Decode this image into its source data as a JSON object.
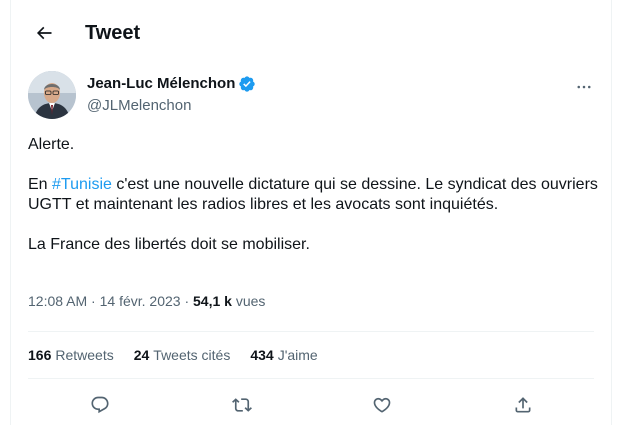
{
  "header": {
    "title": "Tweet",
    "back_icon": "arrow-left-icon"
  },
  "author": {
    "name": "Jean-Luc Mélenchon",
    "handle": "@JLMelenchon",
    "verified_color": "#1d9bf0"
  },
  "tweet": {
    "line1": "Alerte.",
    "p2_prefix": "En ",
    "p2_hashtag": "#Tunisie",
    "p2_rest": " c'est une nouvelle dictature qui se dessine. Le syndicat des ouvriers UGTT et maintenant les radios libres et les avocats sont inquiétés.",
    "line3": "La France des libertés doit se mobiliser."
  },
  "meta": {
    "time": "12:08 AM",
    "sep1": " · ",
    "date": "14 févr. 2023",
    "sep2": " · ",
    "views_count": "54,1 k",
    "views_label": " vues"
  },
  "stats": {
    "retweets_count": "166",
    "retweets_label": "Retweets",
    "quotes_count": "24",
    "quotes_label": "Tweets cités",
    "likes_count": "434",
    "likes_label": "J'aime"
  },
  "actions": [
    "reply-icon",
    "retweet-icon",
    "like-icon",
    "share-icon"
  ],
  "colors": {
    "accent": "#1d9bf0",
    "text": "#0f1419",
    "muted": "#536471",
    "border": "#eff3f4"
  }
}
